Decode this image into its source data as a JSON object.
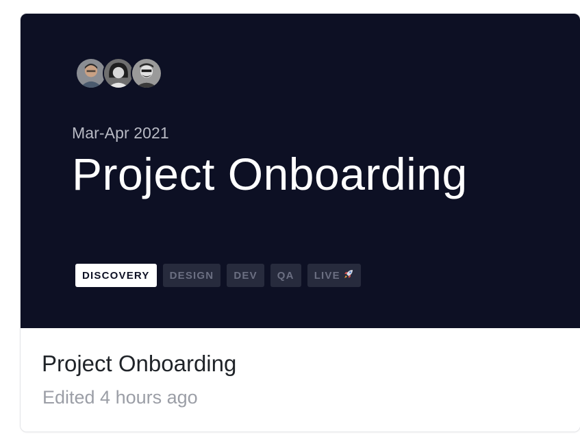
{
  "card": {
    "cover": {
      "date_range": "Mar-Apr 2021",
      "title": "Project Onboarding",
      "avatars": [
        {
          "icon": "person-avatar-1-icon"
        },
        {
          "icon": "person-avatar-2-icon"
        },
        {
          "icon": "person-avatar-3-icon"
        }
      ],
      "stages": [
        {
          "label": "DISCOVERY",
          "active": true
        },
        {
          "label": "DESIGN",
          "active": false
        },
        {
          "label": "DEV",
          "active": false
        },
        {
          "label": "QA",
          "active": false
        },
        {
          "label": "LIVE",
          "active": false,
          "icon": "rocket-icon"
        }
      ]
    },
    "title": "Project Onboarding",
    "edited": "Edited 4 hours ago"
  },
  "colors": {
    "cover_background": "#0d1024",
    "active_stage_bg": "#ffffff",
    "inactive_stage_bg": "#272b3d"
  }
}
